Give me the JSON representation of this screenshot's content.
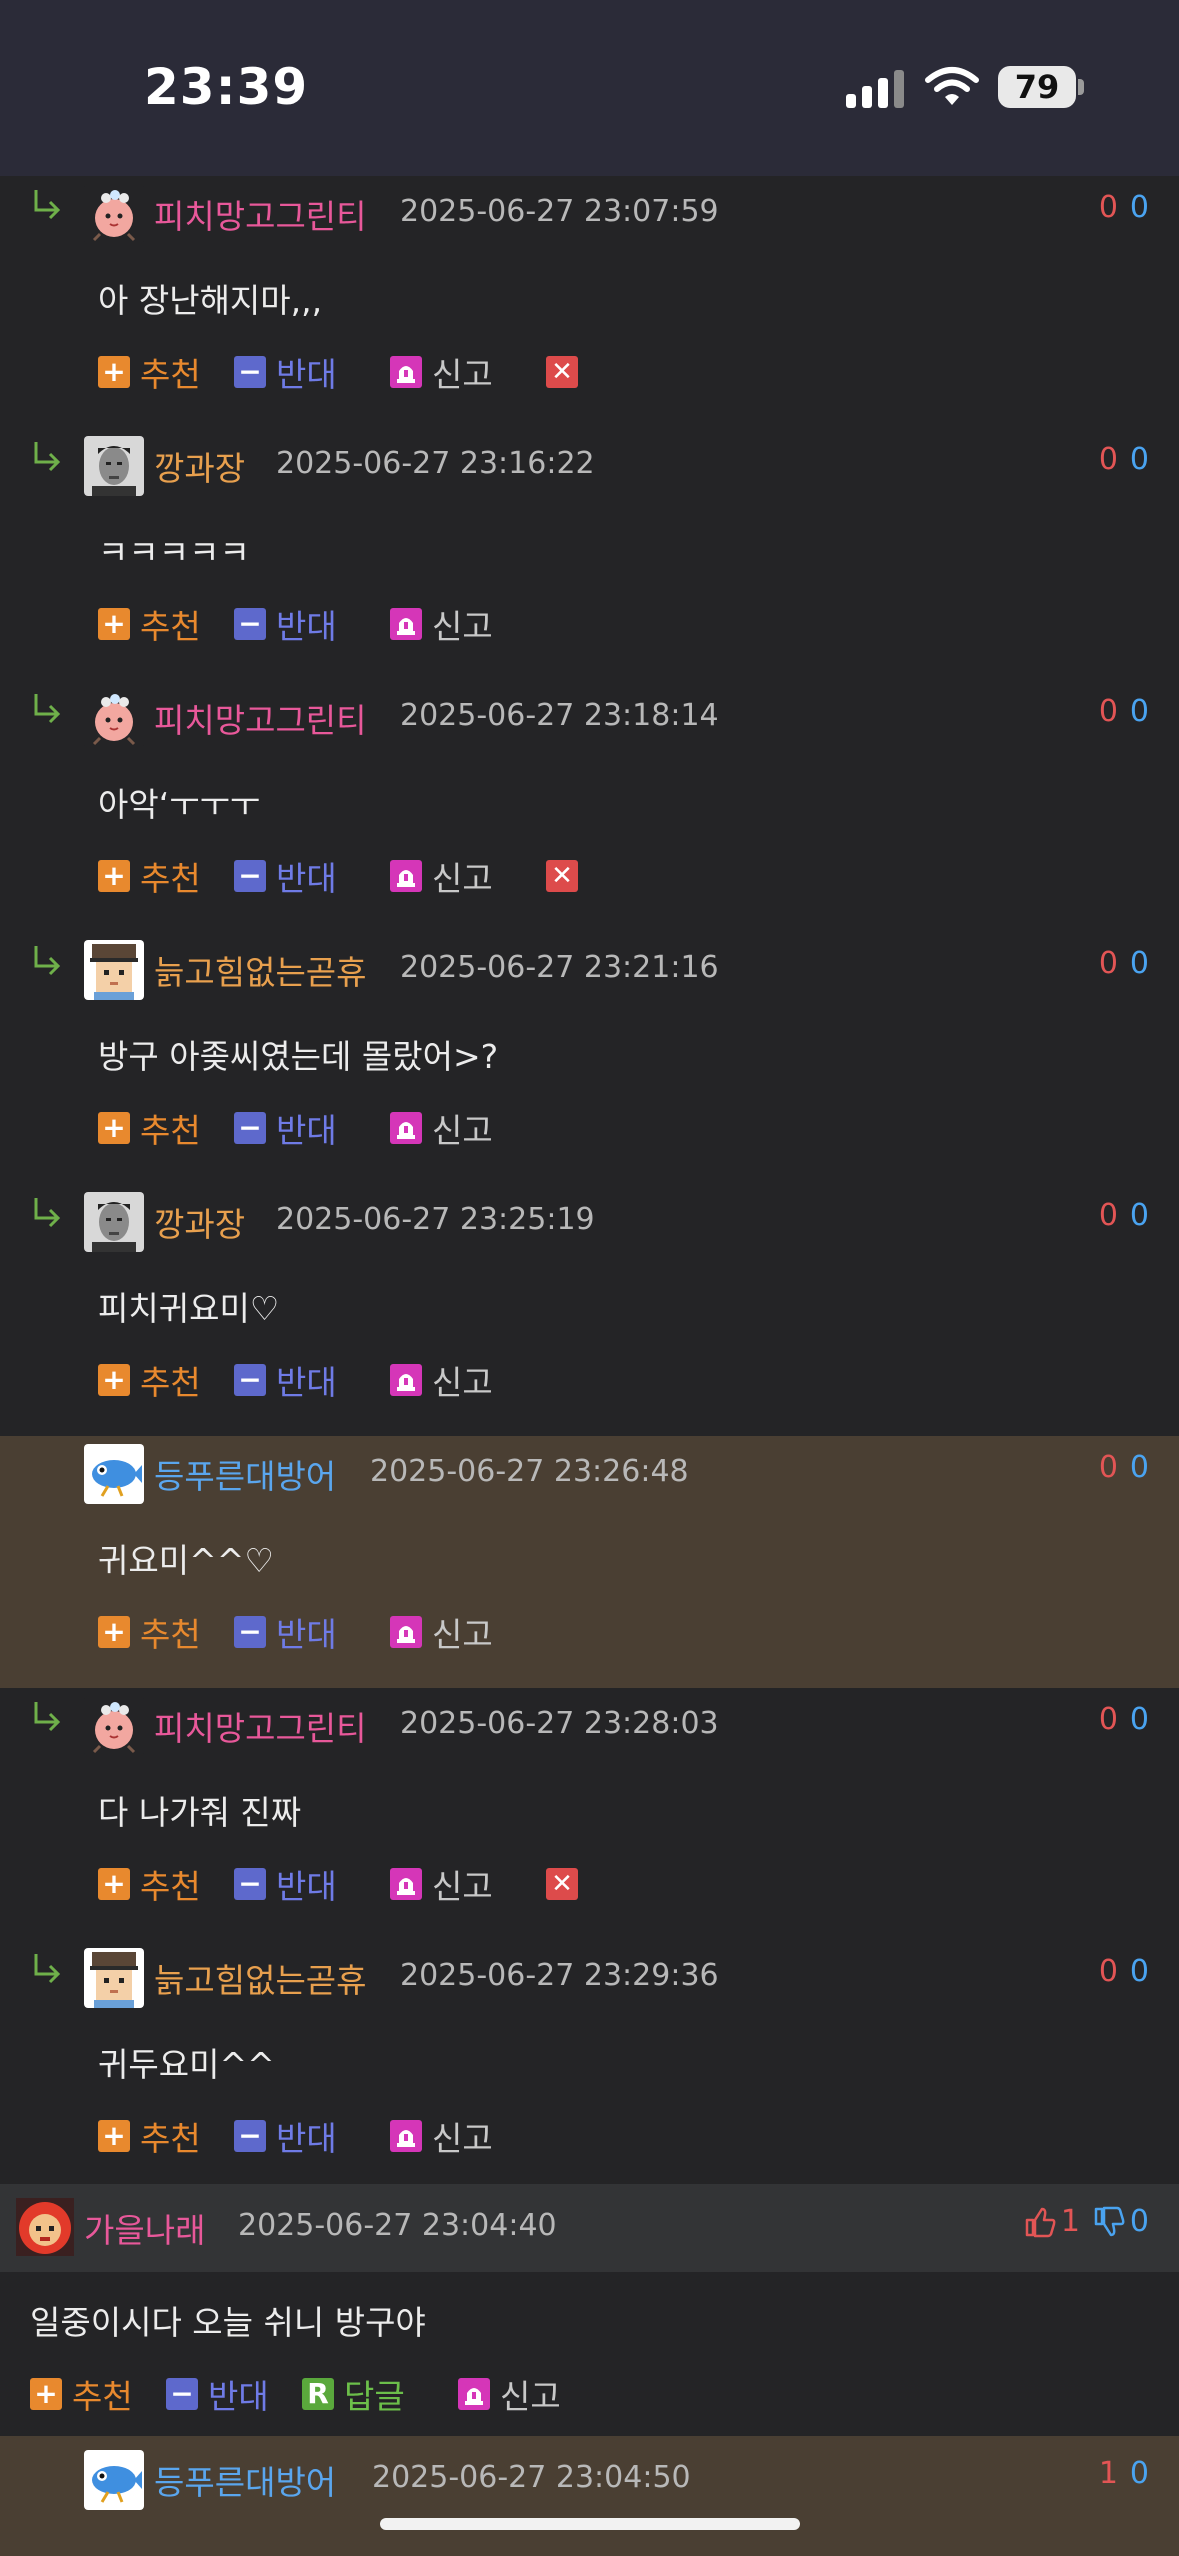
{
  "status_bar": {
    "time": "23:39",
    "battery": "79",
    "icons": [
      "signal-icon",
      "wifi-icon",
      "battery-icon"
    ]
  },
  "comments": [
    {
      "nick": "피치망고그린티",
      "nick_color": "#e8589a",
      "avatar": "peach-character-avatar",
      "date": "2025-06-27 23:07:59",
      "up": "0",
      "down": "0",
      "text": "아 장난해지마,,,",
      "highlight": false,
      "deletable": true
    },
    {
      "nick": "깡과장",
      "nick_color": "#e8a04e",
      "avatar": "man-photo-avatar",
      "date": "2025-06-27 23:16:22",
      "up": "0",
      "down": "0",
      "text": "ㅋㅋㅋㅋㅋ",
      "highlight": false,
      "deletable": false
    },
    {
      "nick": "피치망고그린티",
      "nick_color": "#e8589a",
      "avatar": "peach-character-avatar",
      "date": "2025-06-27 23:18:14",
      "up": "0",
      "down": "0",
      "text": "아악‘ㅜㅜㅜ",
      "highlight": false,
      "deletable": true
    },
    {
      "nick": "늙고힘없는곧휴",
      "nick_color": "#e8a04e",
      "avatar": "pixel-character-avatar",
      "date": "2025-06-27 23:21:16",
      "up": "0",
      "down": "0",
      "text": "방구 아좆씨였는데 몰랐어>?",
      "highlight": false,
      "deletable": false
    },
    {
      "nick": "깡과장",
      "nick_color": "#e8a04e",
      "avatar": "man-photo-avatar",
      "date": "2025-06-27 23:25:19",
      "up": "0",
      "down": "0",
      "text": "피치귀요미♡",
      "highlight": false,
      "deletable": false
    },
    {
      "nick": "등푸른대방어",
      "nick_color": "#5aa6ee",
      "avatar": "fish-character-avatar",
      "date": "2025-06-27 23:26:48",
      "up": "0",
      "down": "0",
      "text": "귀요미^^♡",
      "highlight": true,
      "deletable": false
    },
    {
      "nick": "피치망고그린티",
      "nick_color": "#e8589a",
      "avatar": "peach-character-avatar",
      "date": "2025-06-27 23:28:03",
      "up": "0",
      "down": "0",
      "text": "다 나가줘 진짜",
      "highlight": false,
      "deletable": true
    },
    {
      "nick": "늙고힘없는곧휴",
      "nick_color": "#e8a04e",
      "avatar": "pixel-character-avatar",
      "date": "2025-06-27 23:29:36",
      "up": "0",
      "down": "0",
      "text": "귀두요미^^",
      "highlight": false,
      "deletable": false
    }
  ],
  "actions": {
    "recommend": "추천",
    "oppose": "반대",
    "report": "신고",
    "reply": "답글",
    "recommend_glyph": "+",
    "oppose_glyph": "−",
    "reply_glyph": "R",
    "delete_glyph": "✕"
  },
  "parent_comment": {
    "nick": "가을나래",
    "avatar": "red-lion-avatar",
    "date": "2025-06-27 23:04:40",
    "likes": "1",
    "dislikes": "0",
    "text": "일중이시다 오늘 쉬니 방구야"
  },
  "last_comment": {
    "nick": "등푸른대방어",
    "date": "2025-06-27 23:04:50",
    "up": "1",
    "down": "0"
  },
  "colors": {
    "background": "#242426",
    "highlight_row": "#4a3f33",
    "parent_header": "#333436",
    "upvote": "#e25555",
    "downvote": "#4aa3f0"
  }
}
